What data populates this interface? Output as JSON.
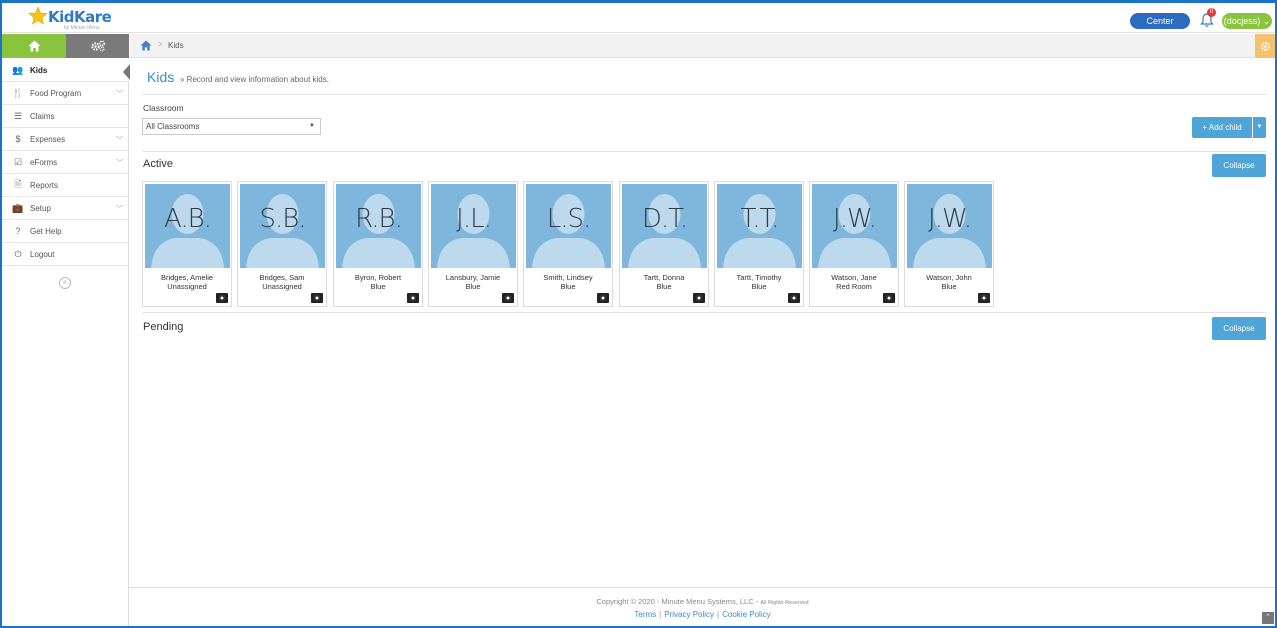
{
  "app": {
    "logo_text": "KidKare",
    "logo_subtext": "by Minute Menu",
    "center_button": "Center",
    "notification_count": "0",
    "user_button": "(docjess) ⌄"
  },
  "sidebar": {
    "items": [
      {
        "label": "Kids",
        "icon": "users-icon",
        "glyph": "👥",
        "chevron": false,
        "active": true
      },
      {
        "label": "Food Program",
        "icon": "utensils-icon",
        "glyph": "🍴",
        "chevron": true,
        "active": false
      },
      {
        "label": "Claims",
        "icon": "list-icon",
        "glyph": "☰",
        "chevron": false,
        "active": false
      },
      {
        "label": "Expenses",
        "icon": "dollar-icon",
        "glyph": "$",
        "chevron": true,
        "active": false
      },
      {
        "label": "eForms",
        "icon": "checkbox-icon",
        "glyph": "☑",
        "chevron": true,
        "active": false
      },
      {
        "label": "Reports",
        "icon": "document-icon",
        "glyph": "🗎",
        "chevron": false,
        "active": false
      },
      {
        "label": "Setup",
        "icon": "briefcase-icon",
        "glyph": "💼",
        "chevron": true,
        "active": false
      },
      {
        "label": "Get Help",
        "icon": "help-icon",
        "glyph": "?",
        "chevron": false,
        "active": false
      },
      {
        "label": "Logout",
        "icon": "power-icon",
        "glyph": "⏻",
        "chevron": false,
        "active": false
      }
    ]
  },
  "breadcrumb": {
    "current": "Kids",
    "separator": ">"
  },
  "page": {
    "title": "Kids",
    "subtitle": "» Record and view information about kids.",
    "classroom_label": "Classroom",
    "classroom_selected": "All Classrooms",
    "add_child_label": "+ Add child"
  },
  "sections": {
    "active_title": "Active",
    "pending_title": "Pending",
    "collapse_label": "Collapse"
  },
  "kids": [
    {
      "initials": "A.B.",
      "name": "Bridges, Amelie",
      "room": "Unassigned"
    },
    {
      "initials": "S.B.",
      "name": "Bridges, Sam",
      "room": "Unassigned"
    },
    {
      "initials": "R.B.",
      "name": "Byron, Robert",
      "room": "Blue"
    },
    {
      "initials": "J.L.",
      "name": "Lansbury, Jamie",
      "room": "Blue"
    },
    {
      "initials": "L.S.",
      "name": "Smith, Lindsey",
      "room": "Blue"
    },
    {
      "initials": "D.T.",
      "name": "Tartt, Donna",
      "room": "Blue"
    },
    {
      "initials": "T.T.",
      "name": "Tartt, Timothy",
      "room": "Blue"
    },
    {
      "initials": "J.W.",
      "name": "Watson, Jane",
      "room": "Red Room"
    },
    {
      "initials": "J.W.",
      "name": "Watson, John",
      "room": "Blue"
    }
  ],
  "footer": {
    "copyright": "Copyright © 2020 - Minute Menu Systems, LLC -",
    "rights": "All Rights Reserved",
    "links": [
      "Terms",
      "Privacy Policy",
      "Cookie Policy"
    ]
  },
  "colors": {
    "brand_blue": "#2d6bc0",
    "brand_green": "#8ac43f",
    "button_blue": "#4ea5d6",
    "avatar_bg": "#7fb6dc",
    "frame": "#1a73c8"
  }
}
